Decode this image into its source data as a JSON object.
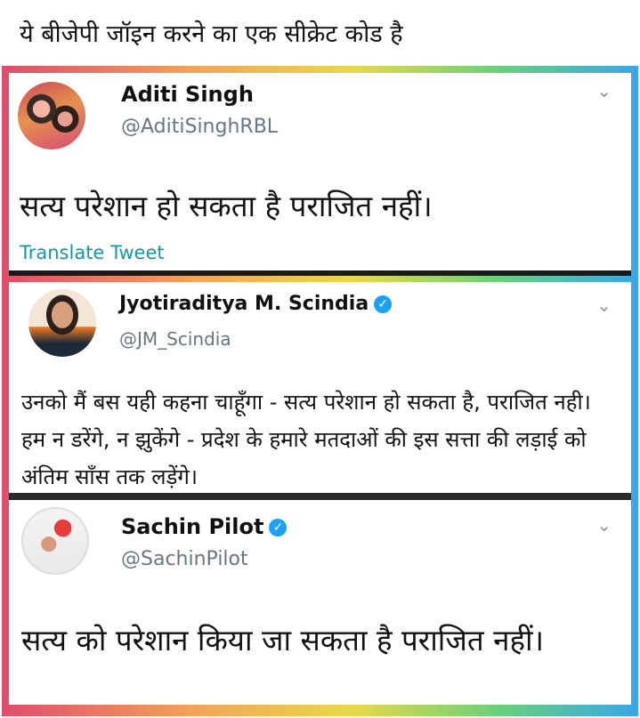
{
  "caption": "ये बीजेपी जॉइन करने का एक सीक्रेट कोड है",
  "tweets": [
    {
      "name": "Aditi Singh",
      "handle": "@AditiSinghRBL",
      "text": "सत्य परेशान हो सकता है पराजित नहीं।",
      "translate": "Translate Tweet",
      "verified": false
    },
    {
      "name": "Jyotiraditya M. Scindia",
      "handle": "@JM_Scindia",
      "text": "उनको मैं बस यही कहना चाहूँगा - सत्य परेशान हो सकता है, पराजित नही। हम न डरेंगे, न झुकेंगे - प्रदेश के हमारे मतदाओं की इस सत्ता की लड़ाई को अंतिम साँस तक लड़ेंगे।",
      "verified": true
    },
    {
      "name": "Sachin Pilot",
      "handle": "@SachinPilot",
      "text": "सत्य को परेशान किया जा सकता है पराजित नहीं।",
      "verified": true
    }
  ],
  "icons": {
    "chevron": "chevron-down-icon",
    "verified": "verified-badge-icon"
  }
}
